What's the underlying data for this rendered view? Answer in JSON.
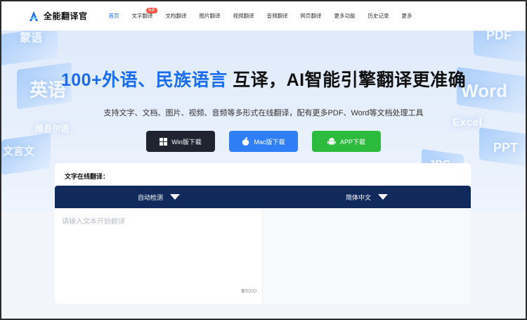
{
  "header": {
    "brand": "全能翻译官",
    "nav": [
      {
        "label": "首页",
        "active": true,
        "badge": ""
      },
      {
        "label": "文字翻译",
        "active": false,
        "badge": "免费"
      },
      {
        "label": "文档翻译",
        "active": false,
        "badge": ""
      },
      {
        "label": "图片翻译",
        "active": false,
        "badge": ""
      },
      {
        "label": "视频翻译",
        "active": false,
        "badge": ""
      },
      {
        "label": "音频翻译",
        "active": false,
        "badge": ""
      },
      {
        "label": "网页翻译",
        "active": false,
        "badge": ""
      },
      {
        "label": "更多功能",
        "active": false,
        "badge": ""
      },
      {
        "label": "历史记录",
        "active": false,
        "badge": ""
      },
      {
        "label": "更多",
        "active": false,
        "badge": ""
      }
    ]
  },
  "hero": {
    "title_highlight": "100+外语、民族语言",
    "title_rest": " 互译，AI智能引擎翻译更准确",
    "subtitle": "支持文字、文档、图片、视频、音频等多形式在线翻译，配有更多PDF、Word等文档处理工具",
    "deco_words": [
      "英语",
      "蒙语",
      "维吾尔语",
      "文言文",
      "PDF",
      "Word",
      "Excel",
      "PPT",
      "JPG"
    ],
    "buttons": {
      "win": "Win版下载",
      "mac": "Mac版下载",
      "app": "APP下载"
    }
  },
  "translator": {
    "section_title": "文字在线翻译：",
    "source_lang": "自动检测",
    "target_lang": "简体中文",
    "input_placeholder": "请输入文本开始翻译",
    "count_current": "0",
    "count_max": "/5000"
  },
  "colors": {
    "accent": "#1a6cf0",
    "lang_bar": "#112a5c",
    "win_button": "#1f2430",
    "mac_button": "#2f7ef5",
    "app_button": "#2dbb3d",
    "badge": "#ff4d3d"
  }
}
